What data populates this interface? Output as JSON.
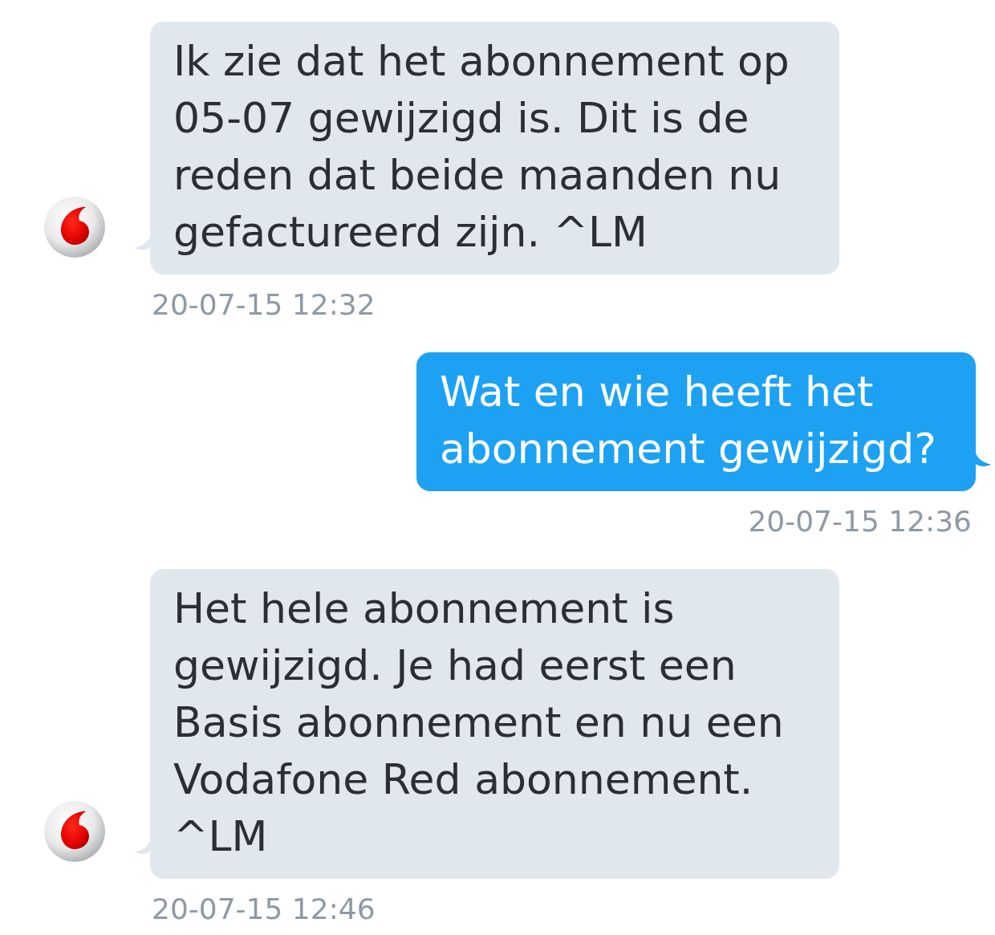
{
  "messages": [
    {
      "kind": "incoming",
      "text": "Ik zie dat het abonnement op 05-07 gewijzigd is. Dit is de reden dat beide maanden nu gefactureerd zijn. ^LM",
      "time": "20-07-15 12:32"
    },
    {
      "kind": "outgoing",
      "text": "Wat en wie heeft het abonnement gewijzigd?",
      "time": "20-07-15 12:36"
    },
    {
      "kind": "incoming",
      "text": "Het hele abonnement is gewijzigd. Je had eerst een Basis abonnement en nu een Vodafone Red abonnement. ^LM",
      "time": "20-07-15 12:46"
    }
  ]
}
